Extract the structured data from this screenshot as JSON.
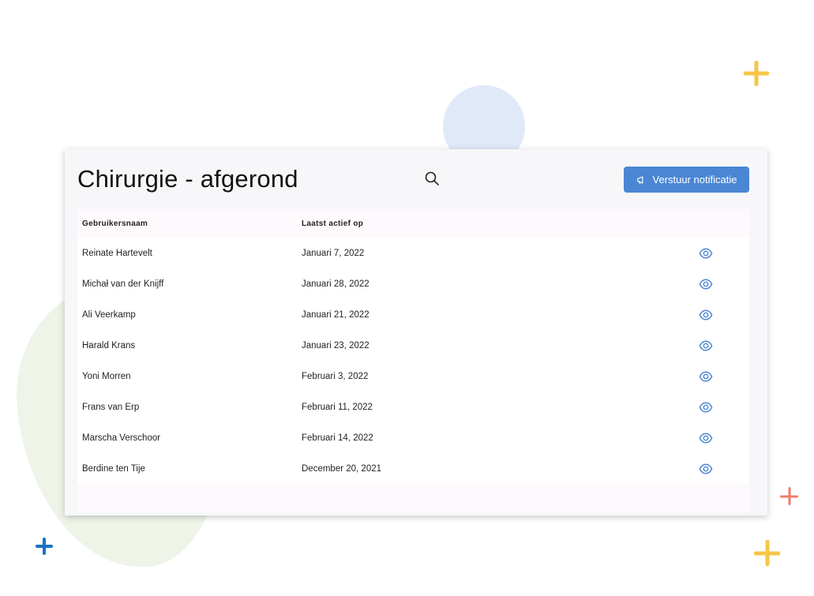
{
  "page": {
    "title": "Chirurgie - afgerond",
    "notify_button": {
      "label": "Verstuur notificatie",
      "icon": "megaphone-icon"
    },
    "search_icon": "search-icon"
  },
  "table": {
    "columns": [
      "Gebruikersnaam",
      "Laatst actief op"
    ],
    "rows": [
      {
        "name": "Reinate Hartevelt",
        "last_active": "Januari 7, 2022"
      },
      {
        "name": "Michał van der Knijff",
        "last_active": "Januari 28, 2022"
      },
      {
        "name": "Ali Veerkamp",
        "last_active": "Januari 21, 2022"
      },
      {
        "name": "Harald Krans",
        "last_active": "Januari 23, 2022"
      },
      {
        "name": "Yoni Morren",
        "last_active": "Februari 3, 2022"
      },
      {
        "name": "Frans van Erp",
        "last_active": "Februari 11, 2022"
      },
      {
        "name": "Marscha Verschoor",
        "last_active": "Februari 14, 2022"
      },
      {
        "name": "Berdine ten Tije",
        "last_active": "December 20, 2021"
      }
    ],
    "row_action_icon": "eye-icon"
  },
  "colors": {
    "accent": "#4a86d4",
    "card_background": "#f7f7fa",
    "decor_yellow": "#f7c548",
    "decor_red": "#ef7d6e",
    "decor_blue": "#1a73c7",
    "decor_green_blob": "#eef4e8",
    "decor_blue_circle": "#dfe9f8"
  }
}
